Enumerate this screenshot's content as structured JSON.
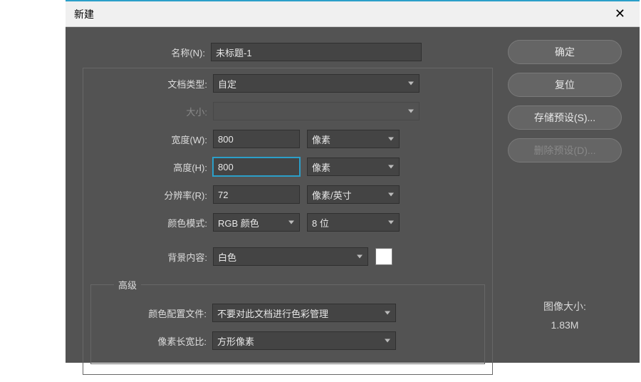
{
  "title": "新建",
  "close_glyph": "✕",
  "labels": {
    "name": "名称(N):",
    "doctype": "文档类型:",
    "size": "大小:",
    "width": "宽度(W):",
    "height": "高度(H):",
    "resolution": "分辨率(R):",
    "color_mode": "颜色模式:",
    "bg": "背景内容:",
    "advanced": "高级",
    "profile": "颜色配置文件:",
    "aspect": "像素长宽比:"
  },
  "fields": {
    "name_value": "未标题-1",
    "doctype_value": "自定",
    "width_value": "800",
    "width_unit": "像素",
    "height_value": "800",
    "height_unit": "像素",
    "resolution_value": "72",
    "resolution_unit": "像素/英寸",
    "color_mode_value": "RGB 颜色",
    "bit_depth": "8 位",
    "bg_value": "白色",
    "profile_value": "不要对此文档进行色彩管理",
    "aspect_value": "方形像素"
  },
  "buttons": {
    "ok": "确定",
    "reset": "复位",
    "save_preset": "存储预设(S)...",
    "delete_preset": "删除预设(D)..."
  },
  "image_size": {
    "label": "图像大小:",
    "value": "1.83M"
  }
}
